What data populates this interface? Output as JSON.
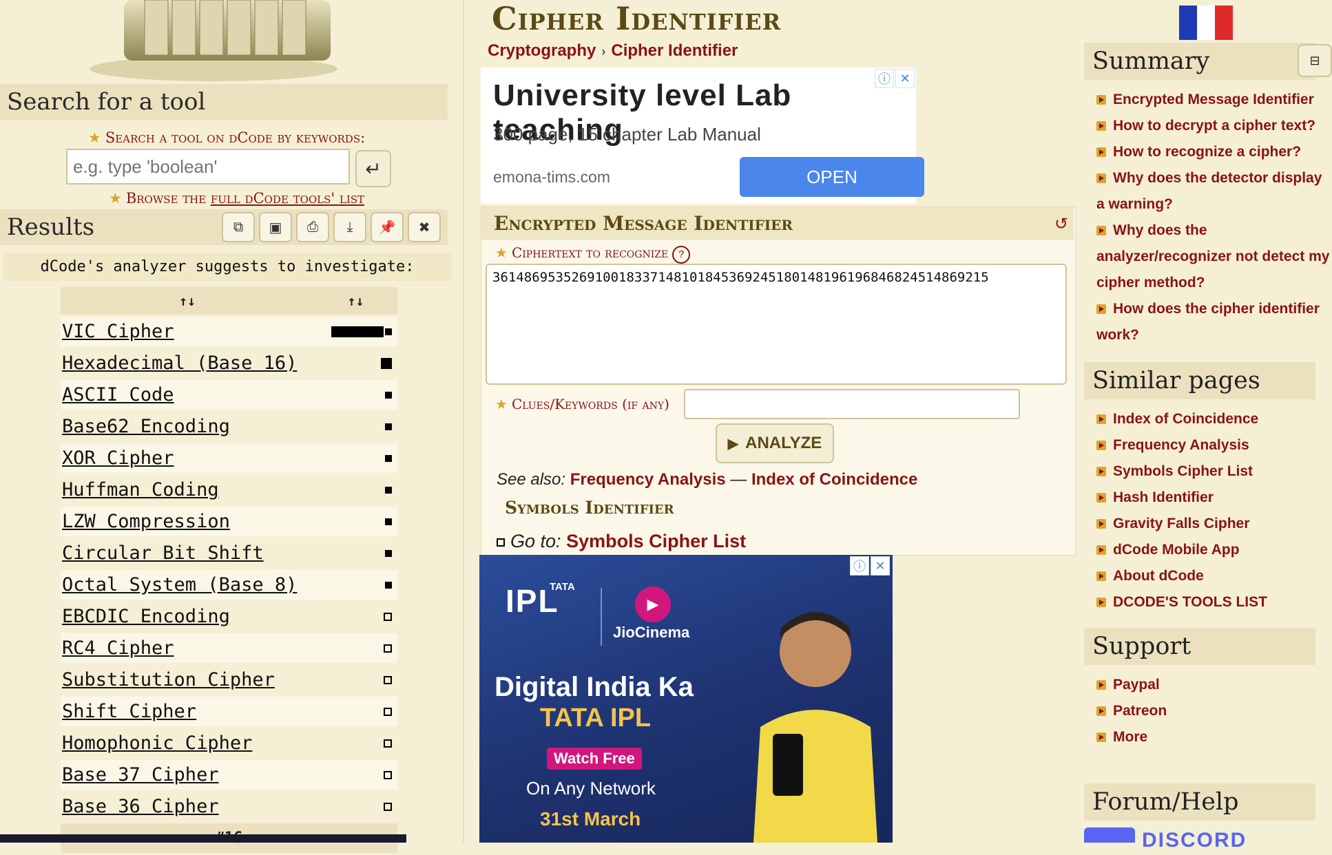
{
  "left": {
    "search_title": "Search for a tool",
    "search_label": "Search a tool on dCode by keywords:",
    "search_placeholder": "e.g. type 'boolean'",
    "browse_prefix": "Browse the ",
    "browse_link": "full dCode tools' list",
    "results_title": "Results",
    "analyzer_head": "dCode's analyzer suggests to investigate:",
    "sort_col1": "↑↓",
    "sort_col2": "↑↓",
    "results": [
      {
        "name": "VIC Cipher",
        "score": 0.9
      },
      {
        "name": "Hexadecimal (Base 16)",
        "score": 0.15
      },
      {
        "name": "ASCII Code",
        "score": 0.1
      },
      {
        "name": "Base62 Encoding",
        "score": 0.1
      },
      {
        "name": "XOR Cipher",
        "score": 0.1
      },
      {
        "name": "Huffman Coding",
        "score": 0.1
      },
      {
        "name": "LZW Compression",
        "score": 0.1
      },
      {
        "name": "Circular Bit Shift",
        "score": 0.1
      },
      {
        "name": "Octal System (Base 8)",
        "score": 0.1
      },
      {
        "name": "EBCDIC Encoding",
        "score": 0
      },
      {
        "name": "RC4 Cipher",
        "score": 0
      },
      {
        "name": "Substitution Cipher",
        "score": 0
      },
      {
        "name": "Shift Cipher",
        "score": 0
      },
      {
        "name": "Homophonic Cipher",
        "score": 0
      },
      {
        "name": "Base 37 Cipher",
        "score": 0
      },
      {
        "name": "Base 36 Cipher",
        "score": 0
      }
    ],
    "results_count": "#16"
  },
  "center": {
    "page_title": "Cipher Identifier",
    "breadcrumb": [
      "Cryptography",
      "Cipher Identifier"
    ],
    "ad1": {
      "headline": "University level Lab teaching",
      "sub": "300 page, 15 chapter Lab Manual",
      "domain": "emona-tims.com",
      "button": "OPEN"
    },
    "tool_title": "Encrypted Message Identifier",
    "ciphertext_label": "Ciphertext to recognize",
    "ciphertext_value": "361486953526910018337148101845369245180148196196846824514869215",
    "clues_label": "Clues/Keywords (if any)",
    "analyze_label": "ANALYZE",
    "see_also_label": "See also:",
    "see_also_links": [
      "Frequency Analysis",
      "Index of Coincidence"
    ],
    "see_also_sep": "—",
    "symbols_title": "Symbols Identifier",
    "goto_label": "Go to:",
    "goto_link": "Symbols Cipher List",
    "ad2": {
      "brand_small": "TATA",
      "brand": "IPL",
      "partner": "JioCinema",
      "headline": "Digital India Ka",
      "headline2": "TATA IPL",
      "cta": "Watch Free",
      "line": "On Any Network",
      "date": "31st March"
    }
  },
  "right": {
    "summary_title": "Summary",
    "summary_items": [
      "Encrypted Message Identifier",
      "How to decrypt a cipher text?",
      "How to recognize a cipher?",
      "Why does the detector display a warning?",
      "Why does the analyzer/recognizer not detect my cipher method?",
      "How does the cipher identifier work?"
    ],
    "similar_title": "Similar pages",
    "similar_items": [
      "Index of Coincidence",
      "Frequency Analysis",
      "Symbols Cipher List",
      "Hash Identifier",
      "Gravity Falls Cipher",
      "dCode Mobile App",
      "About dCode",
      "DCODE'S TOOLS LIST"
    ],
    "support_title": "Support",
    "support_items": [
      "Paypal",
      "Patreon",
      "More"
    ],
    "forum_title": "Forum/Help",
    "discord_text": "DISCORD"
  },
  "colors": {
    "link": "#8a1313",
    "heading": "#5b4a14",
    "background": "#f5efd6",
    "panel": "#ebe1bf",
    "flag_blue": "#1e3bb5",
    "flag_red": "#e02a2a"
  }
}
